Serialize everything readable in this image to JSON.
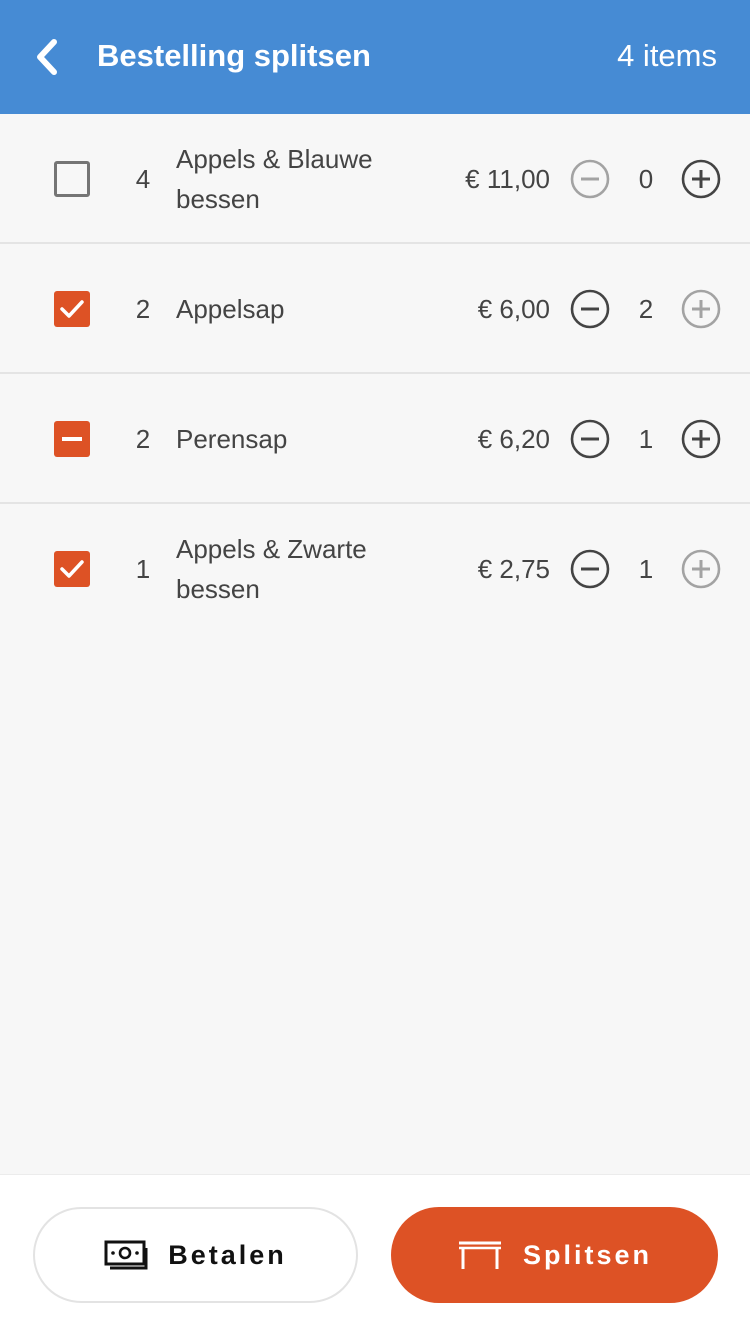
{
  "header": {
    "title": "Bestelling splitsen",
    "count": "4 items",
    "color": "#468bd4"
  },
  "accent_color": "#dd5225",
  "items": [
    {
      "state": "unchecked",
      "qty": "4",
      "name": "Appels & Blauwe bessen",
      "price": "€ 11,00",
      "split_count": "0",
      "minus_enabled": false,
      "plus_enabled": true
    },
    {
      "state": "checked",
      "qty": "2",
      "name": "Appelsap",
      "price": "€ 6,00",
      "split_count": "2",
      "minus_enabled": true,
      "plus_enabled": false
    },
    {
      "state": "partial",
      "qty": "2",
      "name": "Perensap",
      "price": "€ 6,20",
      "split_count": "1",
      "minus_enabled": true,
      "plus_enabled": true
    },
    {
      "state": "checked",
      "qty": "1",
      "name": "Appels & Zwarte bessen",
      "price": "€ 2,75",
      "split_count": "1",
      "minus_enabled": true,
      "plus_enabled": false
    }
  ],
  "footer": {
    "pay_label": "Betalen",
    "pay_icon": "money-icon",
    "split_label": "Splitsen",
    "split_icon": "table-icon"
  }
}
